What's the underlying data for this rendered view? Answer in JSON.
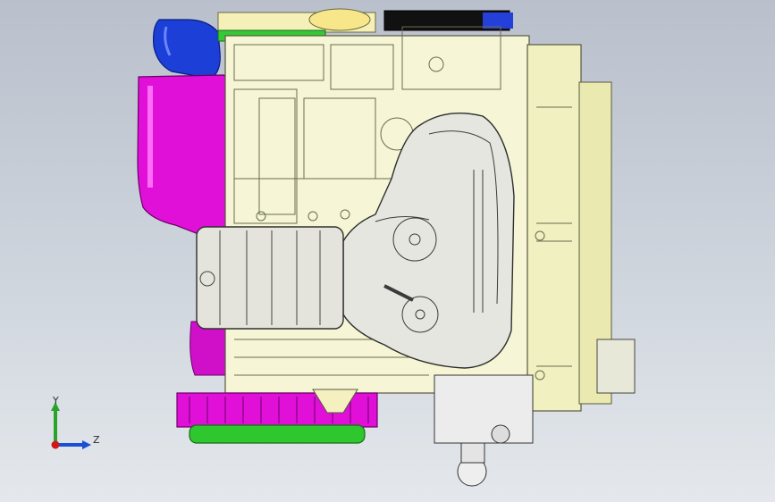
{
  "viewport": {
    "model": "engine-assembly",
    "background_top": "#b9c0cc",
    "background_bottom": "#e4e8ec"
  },
  "triad": {
    "y_label": "Y",
    "z_label": "Z",
    "colors": {
      "y": "#29a329",
      "z": "#1a4fd6",
      "x": "#d01818"
    }
  },
  "parts": [
    {
      "name": "blue-air-duct",
      "color": "#1c3fd8"
    },
    {
      "name": "magenta-intake-box",
      "color": "#e010d8"
    },
    {
      "name": "yellow-engine-block",
      "color": "#f6f6d6"
    },
    {
      "name": "exhaust-manifold",
      "color": "#e6e6e0"
    },
    {
      "name": "flywheel-ring-gear",
      "color": "#e010d8"
    },
    {
      "name": "green-flywheel-plate",
      "color": "#2ec72e"
    },
    {
      "name": "black-belt",
      "color": "#111111"
    },
    {
      "name": "right-side-cover",
      "color": "#f0f0c0"
    }
  ]
}
